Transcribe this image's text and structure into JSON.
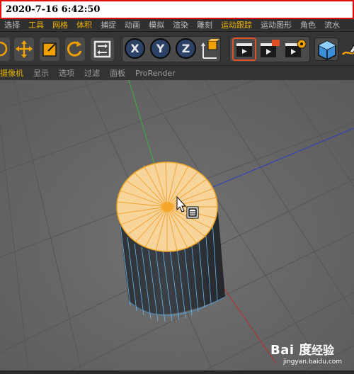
{
  "stamp": {
    "datetime": "2020-7-16 6:42:50"
  },
  "menubar": {
    "items": [
      {
        "label": "选择",
        "highlight": false
      },
      {
        "label": "工具",
        "highlight": true
      },
      {
        "label": "网格",
        "highlight": true
      },
      {
        "label": "体积",
        "highlight": true
      },
      {
        "label": "捕捉",
        "highlight": false
      },
      {
        "label": "动画",
        "highlight": false
      },
      {
        "label": "模拟",
        "highlight": false
      },
      {
        "label": "渲染",
        "highlight": false
      },
      {
        "label": "雕刻",
        "highlight": false
      },
      {
        "label": "运动跟踪",
        "highlight": true
      },
      {
        "label": "运动图形",
        "highlight": false
      },
      {
        "label": "角色",
        "highlight": false
      },
      {
        "label": "流水",
        "highlight": false
      }
    ]
  },
  "toolbar": {
    "axis_x": "X",
    "axis_y": "Y",
    "axis_z": "Z",
    "icons": [
      "live-select-icon",
      "move-icon",
      "scale-icon",
      "rotate-icon",
      "recent-tools-icon",
      "axis-x-icon",
      "axis-y-icon",
      "axis-z-icon",
      "coordinate-system-icon",
      "render-view-icon",
      "render-picture-viewer-icon",
      "render-settings-icon",
      "cube-icon",
      "pen-icon"
    ]
  },
  "subbar": {
    "items": [
      "摄像机",
      "显示",
      "选项",
      "过滤",
      "面板",
      "ProRender"
    ]
  },
  "viewport": {
    "background": "#6b6b6b",
    "selection_color": "#f5a623",
    "object": "cylinder"
  },
  "watermark": {
    "brand": "Bai 度",
    "cn": "经验",
    "url": "jingyan.baidu.com"
  }
}
